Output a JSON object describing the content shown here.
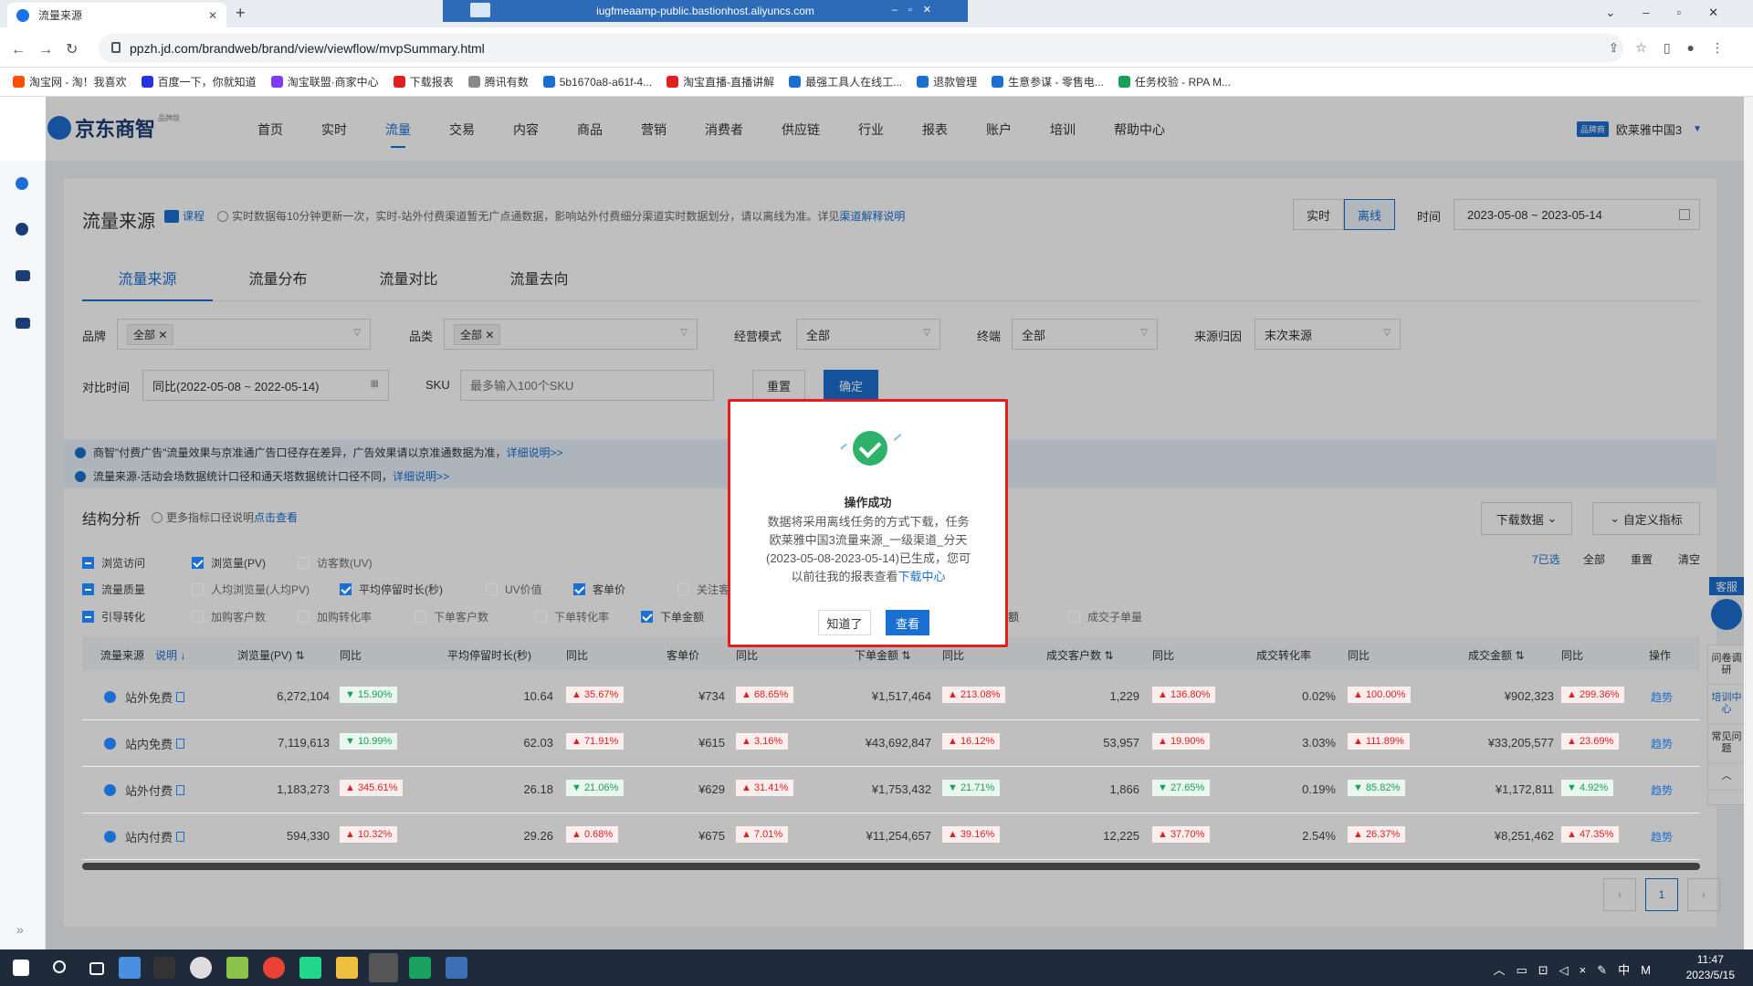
{
  "browser": {
    "tab_title": "流量来源",
    "remote_title": "iugfmeaamp-public.bastionhost.aliyuncs.com",
    "url": "ppzh.jd.com/brandweb/brand/view/viewflow/mvpSummary.html",
    "bookmarks": [
      {
        "label": "淘宝网 - 淘！我喜欢",
        "color": "#ff5000"
      },
      {
        "label": "百度一下，你就知道",
        "color": "#2932e1"
      },
      {
        "label": "淘宝联盟·商家中心",
        "color": "#7a3cff"
      },
      {
        "label": "下载报表",
        "color": "#e02020"
      },
      {
        "label": "腾讯有数",
        "color": "#888888"
      },
      {
        "label": "5b1670a8-a61f-4...",
        "color": "#1b6fd1"
      },
      {
        "label": "淘宝直播-直播讲解",
        "color": "#e02020"
      },
      {
        "label": "最强工具人在线工...",
        "color": "#1b6fd1"
      },
      {
        "label": "退款管理",
        "color": "#1b6fd1"
      },
      {
        "label": "生意参谋 - 零售电...",
        "color": "#1b6fd1"
      },
      {
        "label": "任务校验 - RPA M...",
        "color": "#18a058"
      }
    ]
  },
  "header": {
    "logo": "京东商智",
    "logo_sub": "品牌版",
    "nav": [
      "首页",
      "实时",
      "流量",
      "交易",
      "内容",
      "商品",
      "营销",
      "消费者",
      "供应链",
      "行业",
      "报表",
      "账户",
      "培训",
      "帮助中心"
    ],
    "active_nav": "流量",
    "user_tag": "品牌商",
    "user_name": "欧莱雅中国3"
  },
  "page": {
    "title": "流量来源",
    "course": "课程",
    "notice": "实时数据每10分钟更新一次，实时-站外付费渠道暂无广点通数据，影响站外付费细分渠道实时数据划分，请以离线为准。详见",
    "notice_link": "渠道解释说明",
    "mode_realtime": "实时",
    "mode_offline": "离线",
    "time_label": "时间",
    "date_range": "2023-05-08 ~ 2023-05-14",
    "subtabs": [
      "流量来源",
      "流量分布",
      "流量对比",
      "流量去向"
    ]
  },
  "filters": {
    "brand_label": "品牌",
    "brand_chip": "全部",
    "category_label": "品类",
    "category_chip": "全部",
    "mode_label": "经营模式",
    "mode_value": "全部",
    "terminal_label": "终端",
    "terminal_value": "全部",
    "source_label": "来源归因",
    "source_value": "末次来源",
    "compare_label": "对比时间",
    "compare_value": "同比(2022-05-08 ~ 2022-05-14)",
    "sku_label": "SKU",
    "sku_placeholder": "最多输入100个SKU",
    "reset": "重置",
    "confirm": "确定"
  },
  "info": {
    "line1": "商智\"付费广告\"流量效果与京准通广告口径存在差异，广告效果请以京准通数据为准，",
    "line1_link": "详细说明>>",
    "line2": "流量来源-活动会场数据统计口径和通天塔数据统计口径不同，",
    "line2_link": "详细说明>>"
  },
  "structure": {
    "title": "结构分析",
    "note": "更多指标口径说明",
    "note_link": "点击查看",
    "download": "下载数据",
    "custom": "自定义指标",
    "selected": "7已选",
    "all": "全部",
    "reset": "重置",
    "clear": "清空",
    "groups": [
      {
        "name": "浏览访问",
        "items": [
          {
            "label": "浏览量(PV)",
            "on": true
          },
          {
            "label": "访客数(UV)",
            "on": false
          }
        ]
      },
      {
        "name": "流量质量",
        "items": [
          {
            "label": "人均浏览量(人均PV)",
            "on": false
          },
          {
            "label": "平均停留时长(秒)",
            "on": true
          },
          {
            "label": "UV价值",
            "on": false
          },
          {
            "label": "客单价",
            "on": true
          },
          {
            "label": "关注客",
            "on": false
          }
        ]
      },
      {
        "name": "引导转化",
        "items": [
          {
            "label": "加购客户数",
            "on": false
          },
          {
            "label": "加购转化率",
            "on": false
          },
          {
            "label": "下单客户数",
            "on": false
          },
          {
            "label": "下单转化率",
            "on": false
          },
          {
            "label": "下单金额",
            "on": true
          }
        ]
      }
    ],
    "row3_tail": [
      {
        "label": "额",
        "on": true
      },
      {
        "label": "成交子单量",
        "on": false
      }
    ]
  },
  "table": {
    "headers": {
      "source": "流量来源",
      "explain": "说明 ↓",
      "pv": "浏览量(PV) ⇅",
      "yoy": "同比",
      "stay": "平均停留时长(秒)",
      "aov": "客单价",
      "order_amt": "下单金额 ⇅",
      "deal_cust": "成交客户数 ⇅",
      "deal_rate": "成交转化率",
      "deal_amt": "成交金额 ⇅",
      "op": "操作"
    },
    "rows": [
      {
        "name": "站外免费",
        "pv": "6,272,104",
        "pv_yoy": "▼ 15.90%",
        "pv_dir": "dn",
        "stay": "10.64",
        "stay_yoy": "▲ 35.67%",
        "stay_dir": "up",
        "aov": "¥734",
        "aov_yoy": "▲ 68.65%",
        "aov_dir": "up",
        "oamt": "¥1,517,464",
        "oamt_yoy": "▲ 213.08%",
        "oamt_dir": "up",
        "dcust": "1,229",
        "dcust_yoy": "▲ 136.80%",
        "dcust_dir": "up",
        "drate": "0.02%",
        "drate_yoy": "▲ 100.00%",
        "drate_dir": "up",
        "damt": "¥902,323",
        "damt_yoy": "▲ 299.36%",
        "damt_dir": "up",
        "trend": "趋势"
      },
      {
        "name": "站内免费",
        "pv": "7,119,613",
        "pv_yoy": "▼ 10.99%",
        "pv_dir": "dn",
        "stay": "62.03",
        "stay_yoy": "▲ 71.91%",
        "stay_dir": "up",
        "aov": "¥615",
        "aov_yoy": "▲ 3.16%",
        "aov_dir": "up",
        "oamt": "¥43,692,847",
        "oamt_yoy": "▲ 16.12%",
        "oamt_dir": "up",
        "dcust": "53,957",
        "dcust_yoy": "▲ 19.90%",
        "dcust_dir": "up",
        "drate": "3.03%",
        "drate_yoy": "▲ 111.89%",
        "drate_dir": "up",
        "damt": "¥33,205,577",
        "damt_yoy": "▲ 23.69%",
        "damt_dir": "up",
        "trend": "趋势"
      },
      {
        "name": "站外付费",
        "pv": "1,183,273",
        "pv_yoy": "▲ 345.61%",
        "pv_dir": "up",
        "stay": "26.18",
        "stay_yoy": "▼ 21.06%",
        "stay_dir": "dn",
        "aov": "¥629",
        "aov_yoy": "▲ 31.41%",
        "aov_dir": "up",
        "oamt": "¥1,753,432",
        "oamt_yoy": "▼ 21.71%",
        "oamt_dir": "dn",
        "dcust": "1,866",
        "dcust_yoy": "▼ 27.65%",
        "dcust_dir": "dn",
        "drate": "0.19%",
        "drate_yoy": "▼ 85.82%",
        "drate_dir": "dn",
        "damt": "¥1,172,811",
        "damt_yoy": "▼ 4.92%",
        "damt_dir": "dn",
        "trend": "趋势"
      },
      {
        "name": "站内付费",
        "pv": "594,330",
        "pv_yoy": "▲ 10.32%",
        "pv_dir": "up",
        "stay": "29.26",
        "stay_yoy": "▲ 0.68%",
        "stay_dir": "up",
        "aov": "¥675",
        "aov_yoy": "▲ 7.01%",
        "aov_dir": "up",
        "oamt": "¥11,254,657",
        "oamt_yoy": "▲ 39.16%",
        "oamt_dir": "up",
        "dcust": "12,225",
        "dcust_yoy": "▲ 37.70%",
        "dcust_dir": "up",
        "drate": "2.54%",
        "drate_yoy": "▲ 26.37%",
        "drate_dir": "up",
        "damt": "¥8,251,462",
        "damt_yoy": "▲ 47.35%",
        "damt_dir": "up",
        "trend": "趋势"
      }
    ],
    "page": "1"
  },
  "float": {
    "kefu": "客服",
    "items": [
      "问卷调研",
      "培训中心",
      "常见问题"
    ]
  },
  "dialog": {
    "title": "操作成功",
    "body": "数据将采用离线任务的方式下载，任务欧莱雅中国3流量来源_一级渠道_分天(2023-05-08-2023-05-14)已生成，您可以前往我的报表查看",
    "link": "下载中心",
    "know": "知道了",
    "view": "查看"
  },
  "taskbar": {
    "time": "11:47",
    "date": "2023/5/15",
    "ime": "中"
  }
}
